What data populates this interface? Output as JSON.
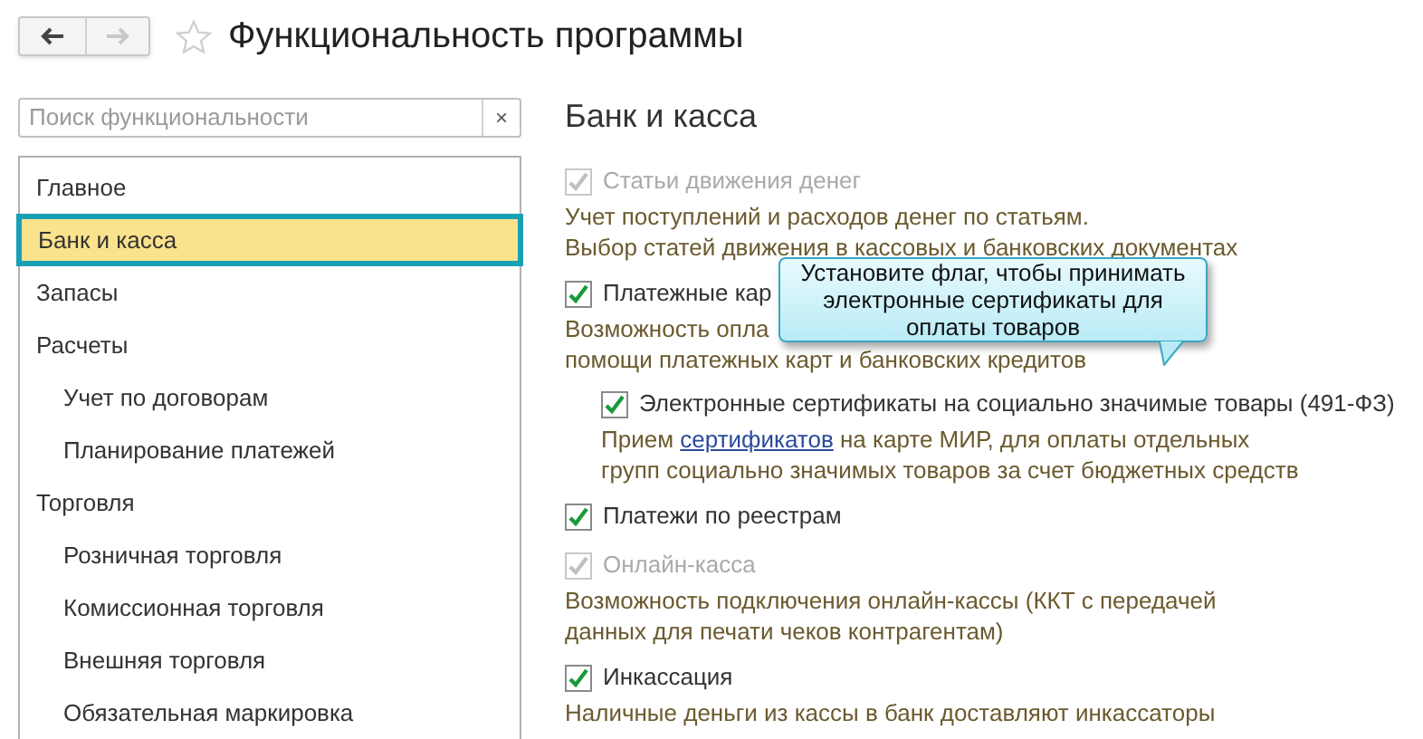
{
  "window": {
    "title": "Функциональность программы",
    "favorite": false
  },
  "search": {
    "placeholder": "Поиск функциональности",
    "clear": "×"
  },
  "sidebar": {
    "items": [
      {
        "label": "Главное",
        "selected": false
      },
      {
        "label": "Банк и касса",
        "selected": true
      },
      {
        "label": "Запасы",
        "selected": false
      },
      {
        "label": "Расчеты",
        "selected": false,
        "children": [
          {
            "label": "Учет по договорам",
            "selected": false
          },
          {
            "label": "Планирование платежей",
            "selected": false
          }
        ]
      },
      {
        "label": "Торговля",
        "selected": false,
        "children": [
          {
            "label": "Розничная торговля",
            "selected": false
          },
          {
            "label": "Комиссионная торговля",
            "selected": false
          },
          {
            "label": "Внешняя торговля",
            "selected": false
          },
          {
            "label": "Обязательная маркировка",
            "selected": false
          }
        ]
      }
    ]
  },
  "section": {
    "title": "Банк и касса",
    "options": [
      {
        "label": "Статьи движения денег",
        "checked": true,
        "disabled": true,
        "description": [
          "Учет поступлений и расходов денег по статьям.",
          "Выбор статей движения в кассовых и банковских документах"
        ]
      },
      {
        "label": "Платежные кар",
        "checked": true,
        "disabled": false,
        "description": [
          "Возможность опла",
          "помощи платежных карт и банковских кредитов"
        ],
        "children": [
          {
            "label": "Электронные сертификаты на социально значимые товары (491-ФЗ)",
            "checked": true,
            "disabled": false,
            "description": [
              {
                "before": "Прием",
                "link": "сертификатов",
                "after": "на карте МИР, для оплаты отдельных"
              },
              "групп социально значимых товаров за счет бюджетных средств"
            ]
          }
        ]
      },
      {
        "label": "Платежи по реестрам",
        "checked": true,
        "disabled": false
      },
      {
        "label": "Онлайн-касса",
        "checked": true,
        "disabled": true,
        "description": [
          "Возможность подключения онлайн-кассы (ККТ с передачей",
          "данных для печати чеков контрагентам)"
        ]
      },
      {
        "label": "Инкассация",
        "checked": true,
        "disabled": false,
        "description": [
          "Наличные деньги из кассы в банк доставляют инкассаторы"
        ]
      }
    ]
  },
  "tooltip": {
    "text": "Установите флаг, чтобы принимать электронные сертификаты для оплаты товаров"
  }
}
